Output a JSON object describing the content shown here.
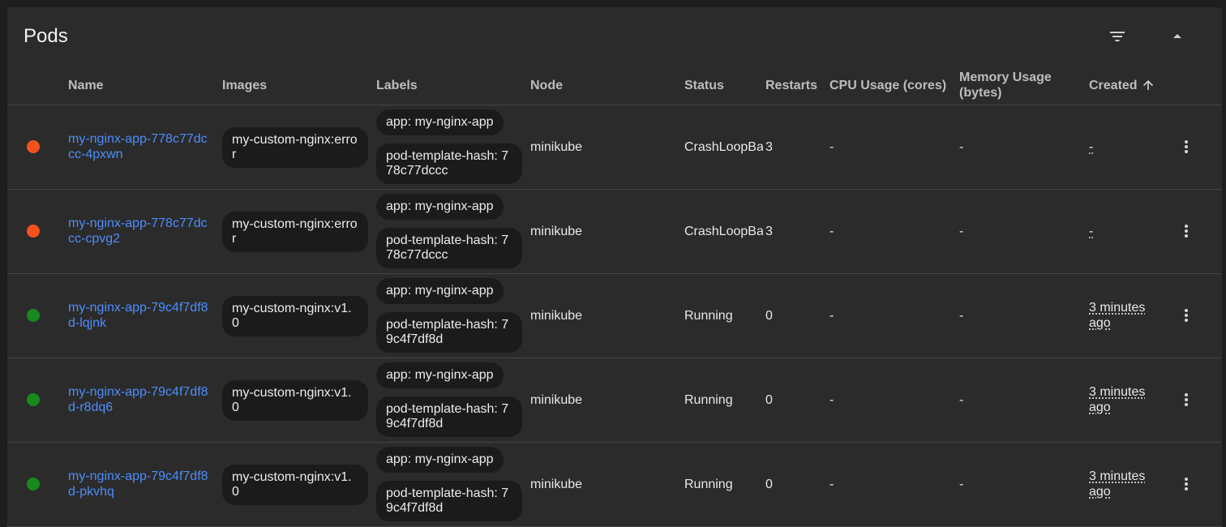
{
  "card": {
    "title": "Pods"
  },
  "header": {
    "filter_icon": "filter-list-icon",
    "collapse_icon": "arrow-drop-up-icon"
  },
  "columns": {
    "name": "Name",
    "images": "Images",
    "labels": "Labels",
    "node": "Node",
    "status": "Status",
    "restarts": "Restarts",
    "cpu": "CPU Usage (cores)",
    "memory": "Memory Usage (bytes)",
    "created": "Created",
    "created_sort_icon": "arrow-upward-icon"
  },
  "colors": {
    "error": "#f4511e",
    "running": "#188a1e",
    "link": "#4d8dfa"
  },
  "rows": [
    {
      "state": "error",
      "name": "my-nginx-app-778c77dccc-4pxwn",
      "image": "my-custom-nginx:error",
      "label_app": "app: my-nginx-app",
      "label_hash": "pod-template-hash: 778c77dccc",
      "node": "minikube",
      "status": "CrashLoopBackOff",
      "restarts": "3",
      "cpu": "-",
      "memory": "-",
      "created": "-"
    },
    {
      "state": "error",
      "name": "my-nginx-app-778c77dccc-cpvg2",
      "image": "my-custom-nginx:error",
      "label_app": "app: my-nginx-app",
      "label_hash": "pod-template-hash: 778c77dccc",
      "node": "minikube",
      "status": "CrashLoopBackOff",
      "restarts": "3",
      "cpu": "-",
      "memory": "-",
      "created": "-"
    },
    {
      "state": "running",
      "name": "my-nginx-app-79c4f7df8d-lqjnk",
      "image": "my-custom-nginx:v1.0",
      "label_app": "app: my-nginx-app",
      "label_hash": "pod-template-hash: 79c4f7df8d",
      "node": "minikube",
      "status": "Running",
      "restarts": "0",
      "cpu": "-",
      "memory": "-",
      "created": "3 minutes ago"
    },
    {
      "state": "running",
      "name": "my-nginx-app-79c4f7df8d-r8dq6",
      "image": "my-custom-nginx:v1.0",
      "label_app": "app: my-nginx-app",
      "label_hash": "pod-template-hash: 79c4f7df8d",
      "node": "minikube",
      "status": "Running",
      "restarts": "0",
      "cpu": "-",
      "memory": "-",
      "created": "3 minutes ago"
    },
    {
      "state": "running",
      "name": "my-nginx-app-79c4f7df8d-pkvhq",
      "image": "my-custom-nginx:v1.0",
      "label_app": "app: my-nginx-app",
      "label_hash": "pod-template-hash: 79c4f7df8d",
      "node": "minikube",
      "status": "Running",
      "restarts": "0",
      "cpu": "-",
      "memory": "-",
      "created": "3 minutes ago"
    }
  ]
}
